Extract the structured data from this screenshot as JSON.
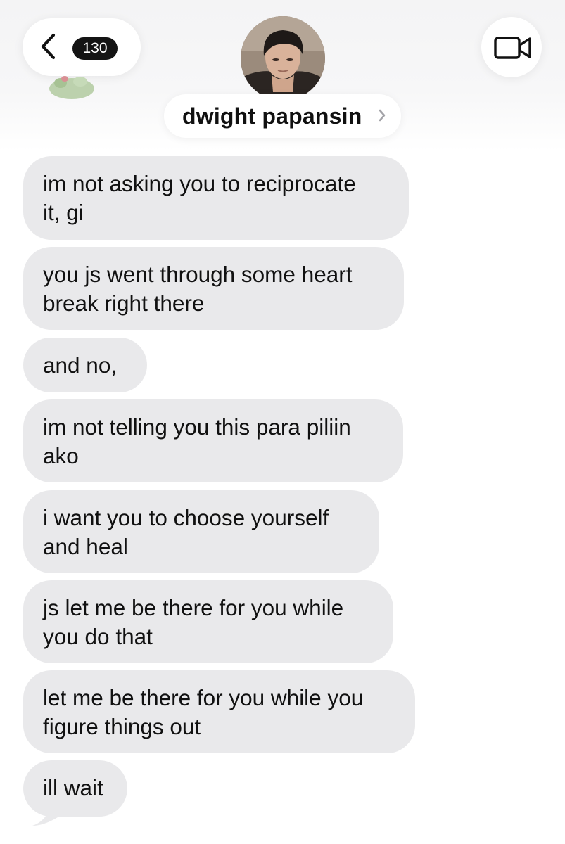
{
  "header": {
    "back_badge": "130",
    "contact_name": "dwight papansin",
    "icons": {
      "back": "chevron-left-icon",
      "name_arrow": "chevron-right-icon",
      "video": "video-camera-icon"
    }
  },
  "messages": [
    {
      "lines": [
        "im not asking you to reciprocate",
        "it, gi"
      ]
    },
    {
      "lines": [
        "you js went through some heart",
        "break right there"
      ]
    },
    {
      "lines": [
        "and no,"
      ]
    },
    {
      "lines": [
        "im not telling you this para piliin",
        "ako"
      ]
    },
    {
      "lines": [
        "i want you to choose yourself",
        "and heal"
      ]
    },
    {
      "lines": [
        "js let me be there for you while",
        "you do that"
      ]
    },
    {
      "lines": [
        "let me be there for you while you",
        "figure things out"
      ]
    },
    {
      "lines": [
        "ill wait"
      ]
    }
  ],
  "colors": {
    "bubble_background": "#e9e9eb",
    "badge_background": "#141414",
    "text": "#111111"
  }
}
